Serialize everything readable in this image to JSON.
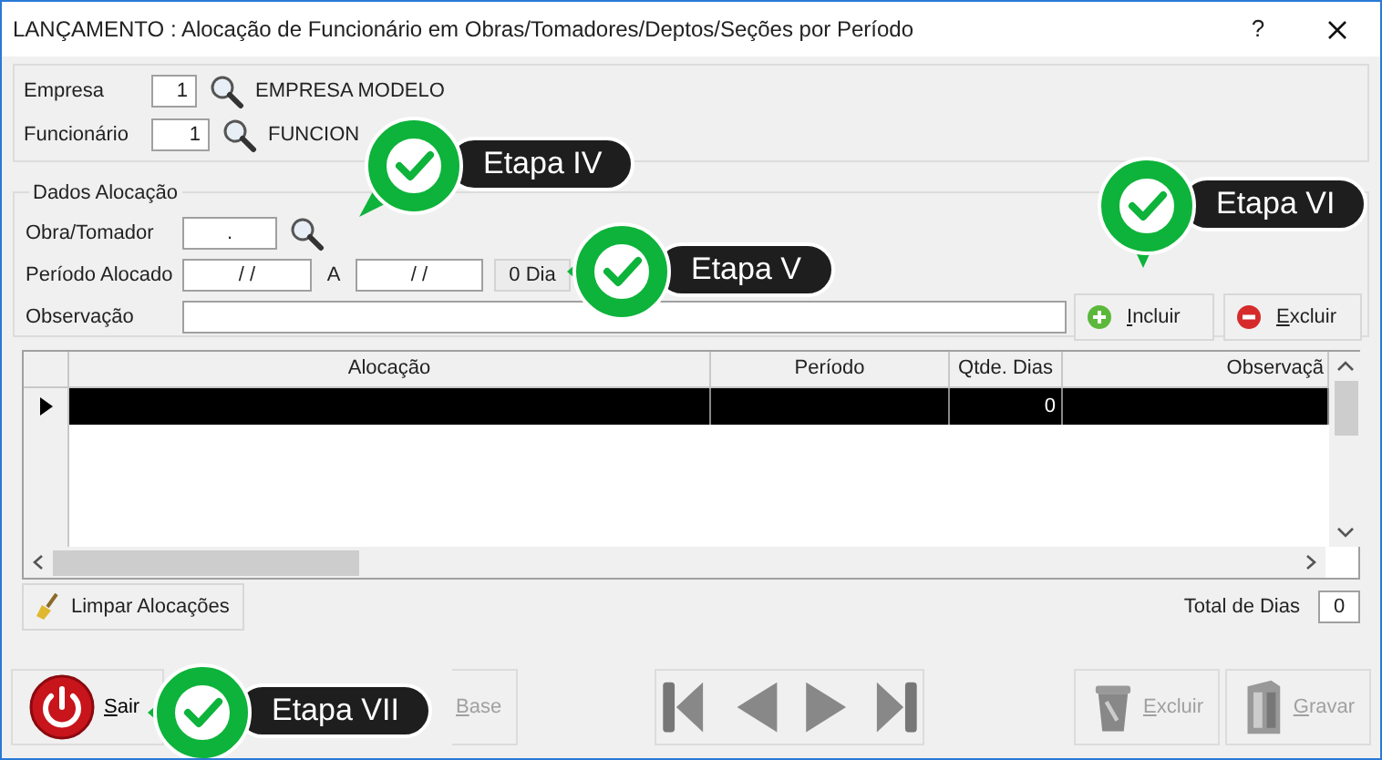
{
  "window": {
    "title": "LANÇAMENTO : Alocação de Funcionário em Obras/Tomadores/Deptos/Seções por Período",
    "help": "?"
  },
  "header": {
    "empresa": {
      "label": "Empresa",
      "code": "1",
      "name": "EMPRESA MODELO"
    },
    "funcionario": {
      "label": "Funcionário",
      "code": "1",
      "name": "FUNCION"
    }
  },
  "alocacao": {
    "title": "Dados Alocação",
    "obra_label": "Obra/Tomador",
    "obra_value": ".",
    "periodo_label": "Período Alocado",
    "start": "/ /",
    "separator": "A",
    "end": "/ /",
    "days": "0 Dia",
    "obs_label": "Observação",
    "buttons": [
      {
        "label": "Incluir",
        "kind": "add"
      },
      {
        "label": "Excluir",
        "kind": "remove"
      }
    ]
  },
  "table": {
    "columns": [
      "Alocação",
      "Período",
      "Qtde. Dias",
      "Observaçã"
    ],
    "rows": [
      {
        "cells": [
          "",
          "",
          "0",
          ""
        ],
        "selected": true
      }
    ]
  },
  "clear_button": "Limpar Alocações",
  "total": {
    "label": "Total de Dias",
    "value": "0"
  },
  "toolbar": {
    "left": [
      {
        "label": "Sair",
        "kind": "power",
        "disabled": false
      },
      {
        "label": "Base",
        "kind": "base",
        "disabled": true
      }
    ],
    "right": [
      {
        "label": "Excluir",
        "kind": "trash",
        "disabled": true
      },
      {
        "label": "Gravar",
        "kind": "save",
        "disabled": true
      }
    ]
  },
  "callouts": [
    {
      "label": "Etapa IV",
      "kind": "diagonal"
    },
    {
      "label": "Etapa V",
      "kind": "side"
    },
    {
      "label": "Etapa VI",
      "kind": "down"
    },
    {
      "label": "Etapa VII",
      "kind": "side"
    }
  ]
}
